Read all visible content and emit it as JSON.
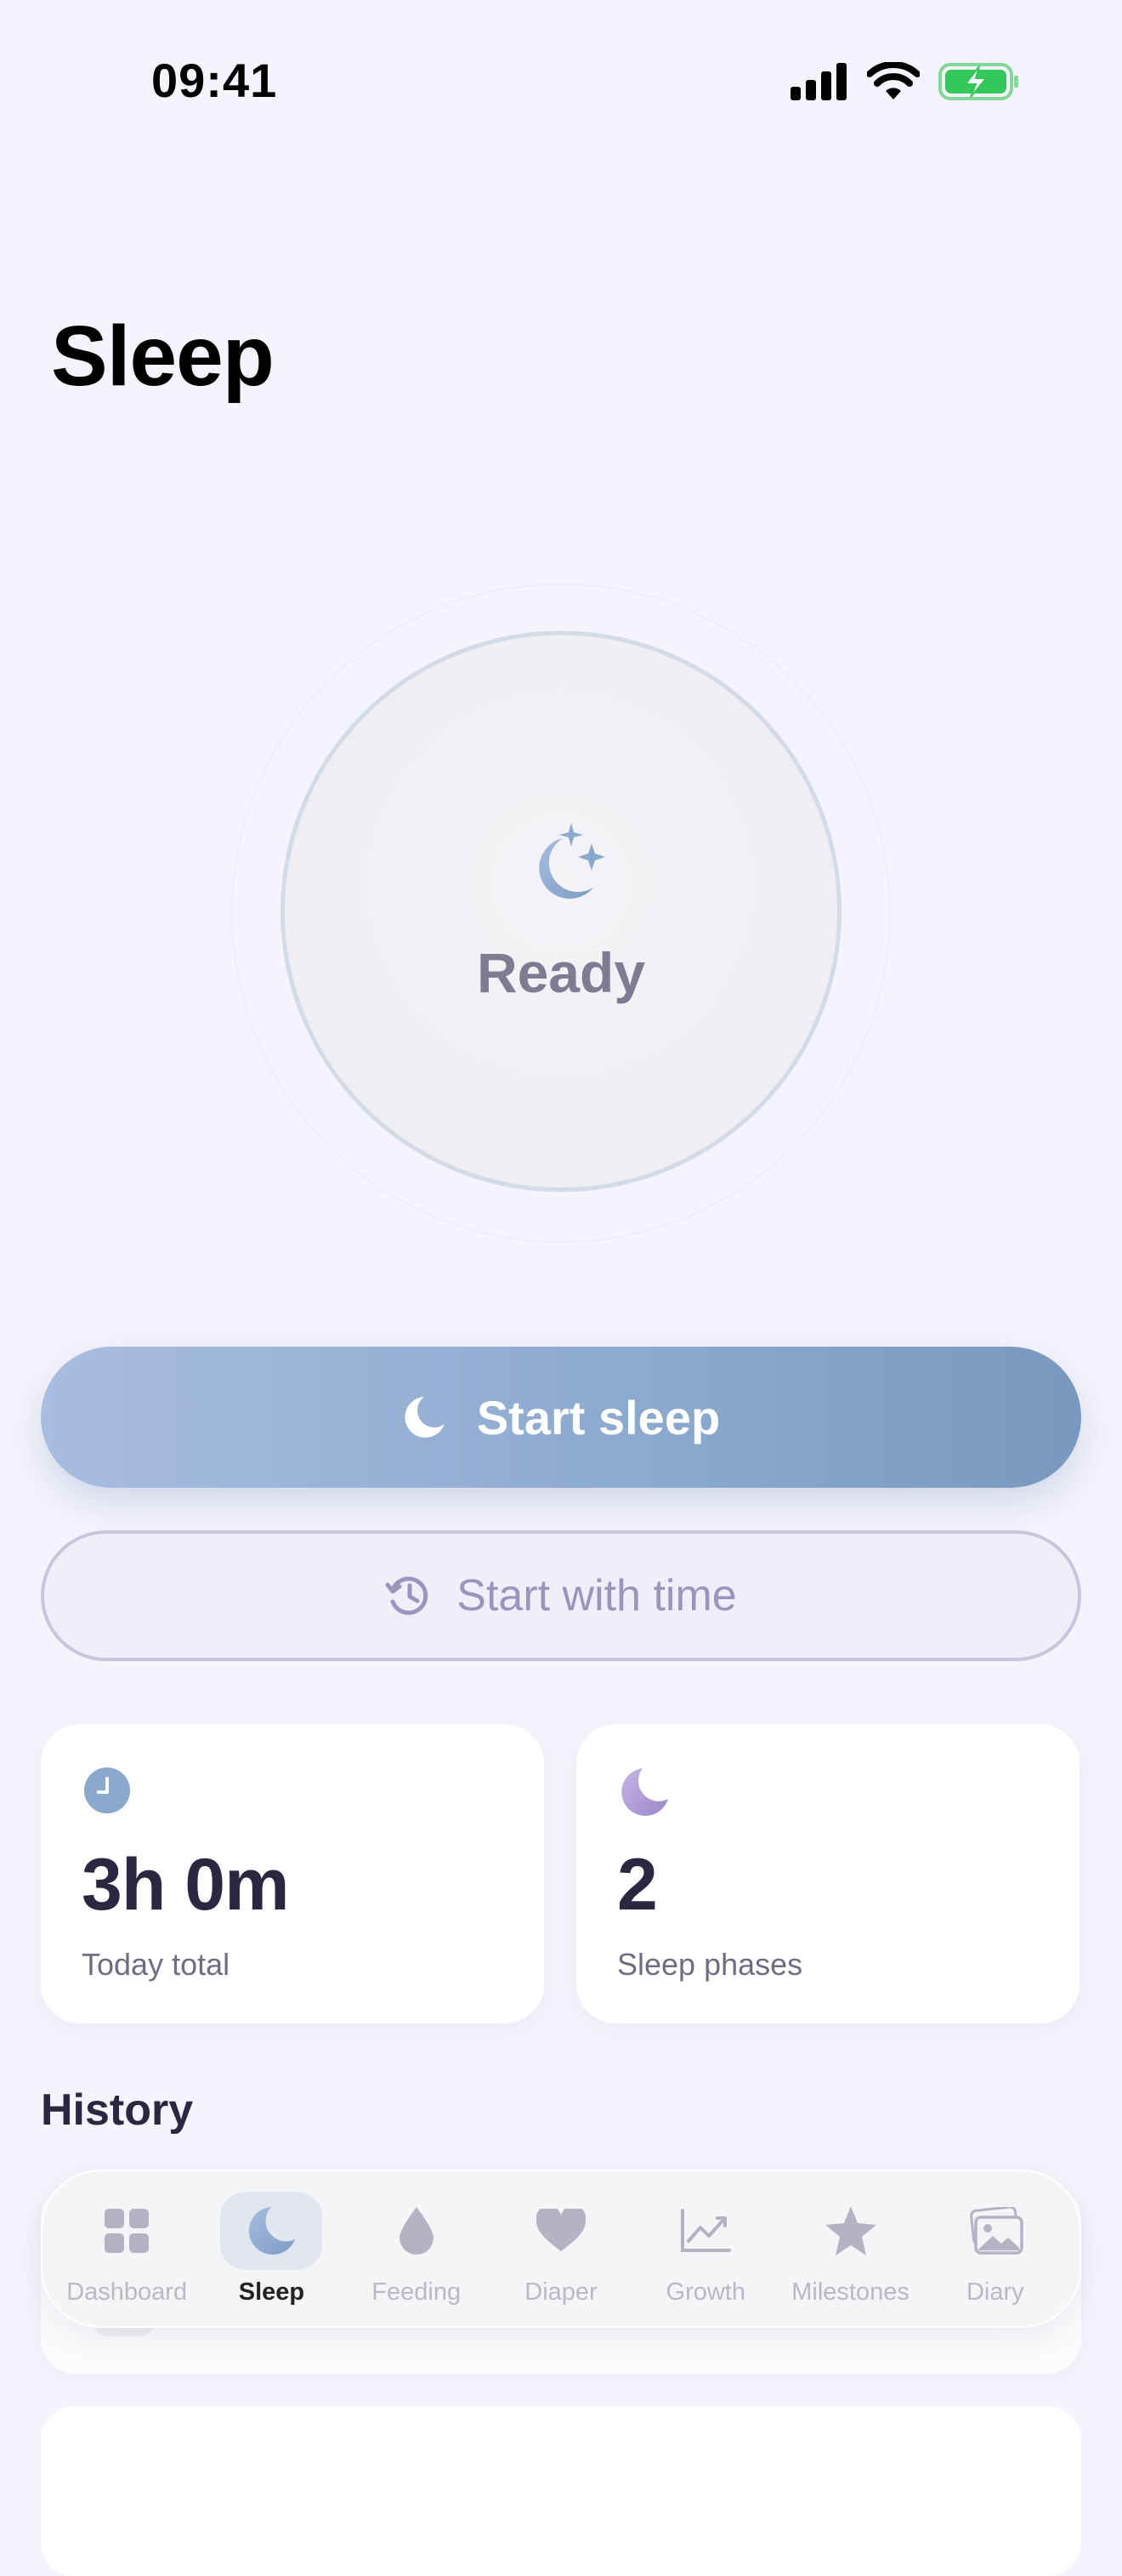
{
  "status_bar": {
    "time": "09:41"
  },
  "page": {
    "title": "Sleep"
  },
  "timer": {
    "state_label": "Ready"
  },
  "actions": {
    "start_sleep": "Start sleep",
    "start_with_time": "Start with time"
  },
  "stats": [
    {
      "value": "3h 0m",
      "label": "Today total",
      "icon": "clock-icon"
    },
    {
      "value": "2",
      "label": "Sleep phases",
      "icon": "moon-icon"
    }
  ],
  "history": {
    "heading": "History"
  },
  "tabs": [
    {
      "label": "Dashboard",
      "icon": "grid-icon",
      "active": false
    },
    {
      "label": "Sleep",
      "icon": "moon-icon",
      "active": true
    },
    {
      "label": "Feeding",
      "icon": "drop-icon",
      "active": false
    },
    {
      "label": "Diaper",
      "icon": "heart-icon",
      "active": false
    },
    {
      "label": "Growth",
      "icon": "chart-icon",
      "active": false
    },
    {
      "label": "Milestones",
      "icon": "star-icon",
      "active": false
    },
    {
      "label": "Diary",
      "icon": "photos-icon",
      "active": false
    }
  ],
  "colors": {
    "accent": "#8aa9cd",
    "secondary": "#9c94bd",
    "background": "#f5f3fb",
    "battery": "#34c759"
  }
}
